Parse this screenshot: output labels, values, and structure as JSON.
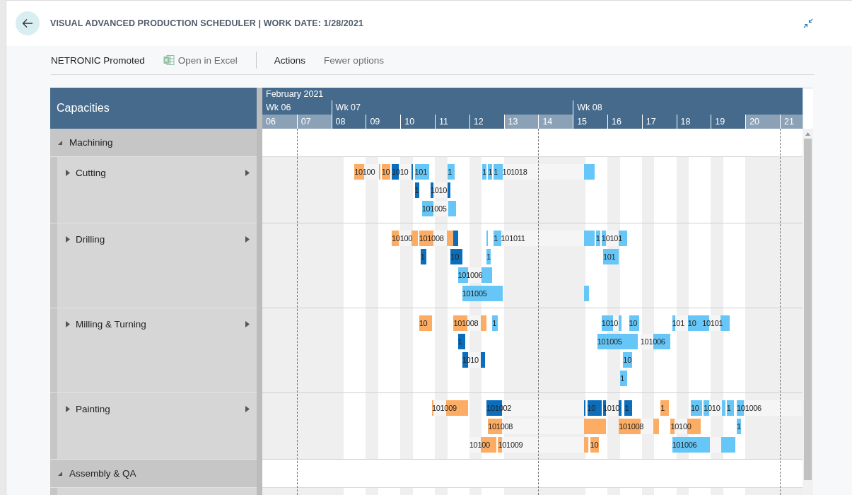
{
  "header": {
    "title": "VISUAL ADVANCED PRODUCTION SCHEDULER | WORK DATE: 1/28/2021"
  },
  "toolbar": [
    {
      "kind": "action",
      "label": "NETRONIC Promoted",
      "muted": false
    },
    {
      "kind": "excel",
      "label": "Open in Excel",
      "muted": true
    },
    {
      "kind": "separator"
    },
    {
      "kind": "action",
      "label": "Actions",
      "muted": false
    },
    {
      "kind": "action",
      "label": "Fewer options",
      "muted": true
    }
  ],
  "scheduler": {
    "panel_title": "Capacities",
    "month": "February 2021",
    "days": [
      {
        "label": "06",
        "weekend": true,
        "dashed": false,
        "week": "Wk 06"
      },
      {
        "label": "07",
        "weekend": true,
        "dashed": true
      },
      {
        "label": "08",
        "weekend": false,
        "dashed": false,
        "week": "Wk 07"
      },
      {
        "label": "09",
        "weekend": false,
        "dashed": false
      },
      {
        "label": "10",
        "weekend": false,
        "dashed": false
      },
      {
        "label": "11",
        "weekend": false,
        "dashed": false
      },
      {
        "label": "12",
        "weekend": false,
        "dashed": false
      },
      {
        "label": "13",
        "weekend": true,
        "dashed": false
      },
      {
        "label": "14",
        "weekend": true,
        "dashed": true
      },
      {
        "label": "15",
        "weekend": false,
        "dashed": false,
        "week": "Wk 08"
      },
      {
        "label": "16",
        "weekend": false,
        "dashed": false
      },
      {
        "label": "17",
        "weekend": false,
        "dashed": false
      },
      {
        "label": "18",
        "weekend": false,
        "dashed": false
      },
      {
        "label": "19",
        "weekend": false,
        "dashed": false
      },
      {
        "label": "20",
        "weekend": true,
        "dashed": false
      },
      {
        "label": "21",
        "weekend": true,
        "dashed": true
      }
    ],
    "groups": [
      {
        "name": "Machining",
        "expanded": true,
        "resources": [
          {
            "name": "Cutting",
            "expanded": false,
            "lanes": [
              {
                "tasks": [
                  {
                    "color": "#fdad63",
                    "label": "10100"
                  },
                  {
                    "color": "#fdad63"
                  },
                  {
                    "color": "#fdad63",
                    "label": "10"
                  },
                  {
                    "color": "#0a6ebd",
                    "label": "1010"
                  },
                  {
                    "color": "#0a6ebd"
                  },
                  {
                    "color": "#66c6f7",
                    "label": "101"
                  },
                  {
                    "color": "#66c6f7",
                    "label": "1"
                  },
                  {
                    "color": "#66c6f7",
                    "label": "1"
                  },
                  {
                    "color": "#66c6f7",
                    "label": "1"
                  },
                  {
                    "color": "#66c6f7",
                    "label": "1"
                  },
                  {
                    "color": "#f5f5f5",
                    "label": "101018"
                  },
                  {
                    "color": "#66c6f7"
                  }
                ]
              },
              {
                "tasks": [
                  {
                    "color": "#0a6ebd",
                    "label": "1"
                  },
                  {
                    "color": "#0a6ebd",
                    "label": "1010"
                  }
                ]
              },
              {
                "tasks": [
                  {
                    "color": "#66c6f7",
                    "label": "101005"
                  }
                ]
              }
            ]
          },
          {
            "name": "Drilling",
            "expanded": false,
            "lanes": [
              {
                "tasks": [
                  {
                    "color": "#fdad63",
                    "label": "10100"
                  },
                  {
                    "color": "#fdad63",
                    "label": "101008"
                  },
                  {
                    "color": "#0a6ebd"
                  },
                  {
                    "color": "#66c6f7"
                  },
                  {
                    "color": "#66c6f7",
                    "label": "1"
                  },
                  {
                    "color": "#f5f5f5",
                    "label": "101011"
                  },
                  {
                    "color": "#66c6f7"
                  },
                  {
                    "color": "#66c6f7",
                    "label": "1"
                  },
                  {
                    "color": "#66c6f7",
                    "label": "10101"
                  }
                ]
              },
              {
                "tasks": [
                  {
                    "color": "#0a6ebd",
                    "label": "1"
                  },
                  {
                    "color": "#0a6ebd",
                    "label": "10"
                  },
                  {
                    "color": "#66c6f7",
                    "label": "1"
                  },
                  {
                    "color": "#66c6f7",
                    "label": "101"
                  }
                ]
              },
              {
                "tasks": [
                  {
                    "color": "#66c6f7",
                    "label": "101006"
                  }
                ]
              },
              {
                "tasks": [
                  {
                    "color": "#66c6f7",
                    "label": "101005"
                  },
                  {
                    "color": "#66c6f7"
                  }
                ]
              }
            ]
          },
          {
            "name": "Milling & Turning",
            "expanded": false,
            "lanes": [
              {
                "tasks": [
                  {
                    "color": "#fdad63",
                    "label": "10"
                  },
                  {
                    "color": "#fdad63",
                    "label": "101008"
                  },
                  {
                    "color": "#66c6f7",
                    "label": "1"
                  },
                  {
                    "color": "#66c6f7",
                    "label": "1010"
                  },
                  {
                    "color": "#66c6f7",
                    "label": "10"
                  },
                  {
                    "color": "#66c6f7",
                    "label": "101"
                  },
                  {
                    "color": "#66c6f7",
                    "label": "10"
                  },
                  {
                    "color": "#66c6f7",
                    "label": "10101"
                  }
                ]
              },
              {
                "tasks": [
                  {
                    "color": "#0a6ebd",
                    "label": "1"
                  },
                  {
                    "color": "#66c6f7",
                    "label": "101005"
                  },
                  {
                    "color": "#66c6f7",
                    "label": "101006"
                  }
                ]
              },
              {
                "tasks": [
                  {
                    "color": "#0a6ebd",
                    "label": "1010"
                  },
                  {
                    "color": "#66c6f7",
                    "label": "10"
                  }
                ]
              },
              {
                "tasks": [
                  {
                    "color": "#66c6f7",
                    "label": "1"
                  }
                ]
              }
            ]
          },
          {
            "name": "Painting",
            "expanded": false,
            "lanes": [
              {
                "tasks": [
                  {
                    "color": "#fdad63",
                    "label": "101009"
                  },
                  {
                    "color": "#0a6ebd",
                    "label": "101002"
                  },
                  {
                    "color": "#0a6ebd"
                  },
                  {
                    "color": "#0a6ebd",
                    "label": "10"
                  },
                  {
                    "color": "#0a6ebd",
                    "label": "1010"
                  },
                  {
                    "color": "#0a6ebd",
                    "label": "1"
                  },
                  {
                    "color": "#fdad63",
                    "label": "1"
                  },
                  {
                    "color": "#66c6f7",
                    "label": "10"
                  },
                  {
                    "color": "#66c6f7",
                    "label": "1010"
                  },
                  {
                    "color": "#66c6f7",
                    "label": "1"
                  },
                  {
                    "color": "#66c6f7",
                    "label": "101006"
                  }
                ]
              },
              {
                "tasks": [
                  {
                    "color": "#fdad63",
                    "label": "101008"
                  },
                  {
                    "color": "#fdad63",
                    "label": "101008"
                  },
                  {
                    "color": "#fdad63",
                    "label": "10100"
                  },
                  {
                    "color": "#66c6f7",
                    "label": "1"
                  }
                ]
              },
              {
                "tasks": [
                  {
                    "color": "#fdad63",
                    "label": "10100"
                  },
                  {
                    "color": "#fdad63",
                    "label": "101009"
                  },
                  {
                    "color": "#fdad63",
                    "label": "10"
                  },
                  {
                    "color": "#66c6f7",
                    "label": "101006"
                  }
                ]
              }
            ]
          }
        ]
      },
      {
        "name": "Assembly & QA",
        "expanded": true
      }
    ]
  }
}
